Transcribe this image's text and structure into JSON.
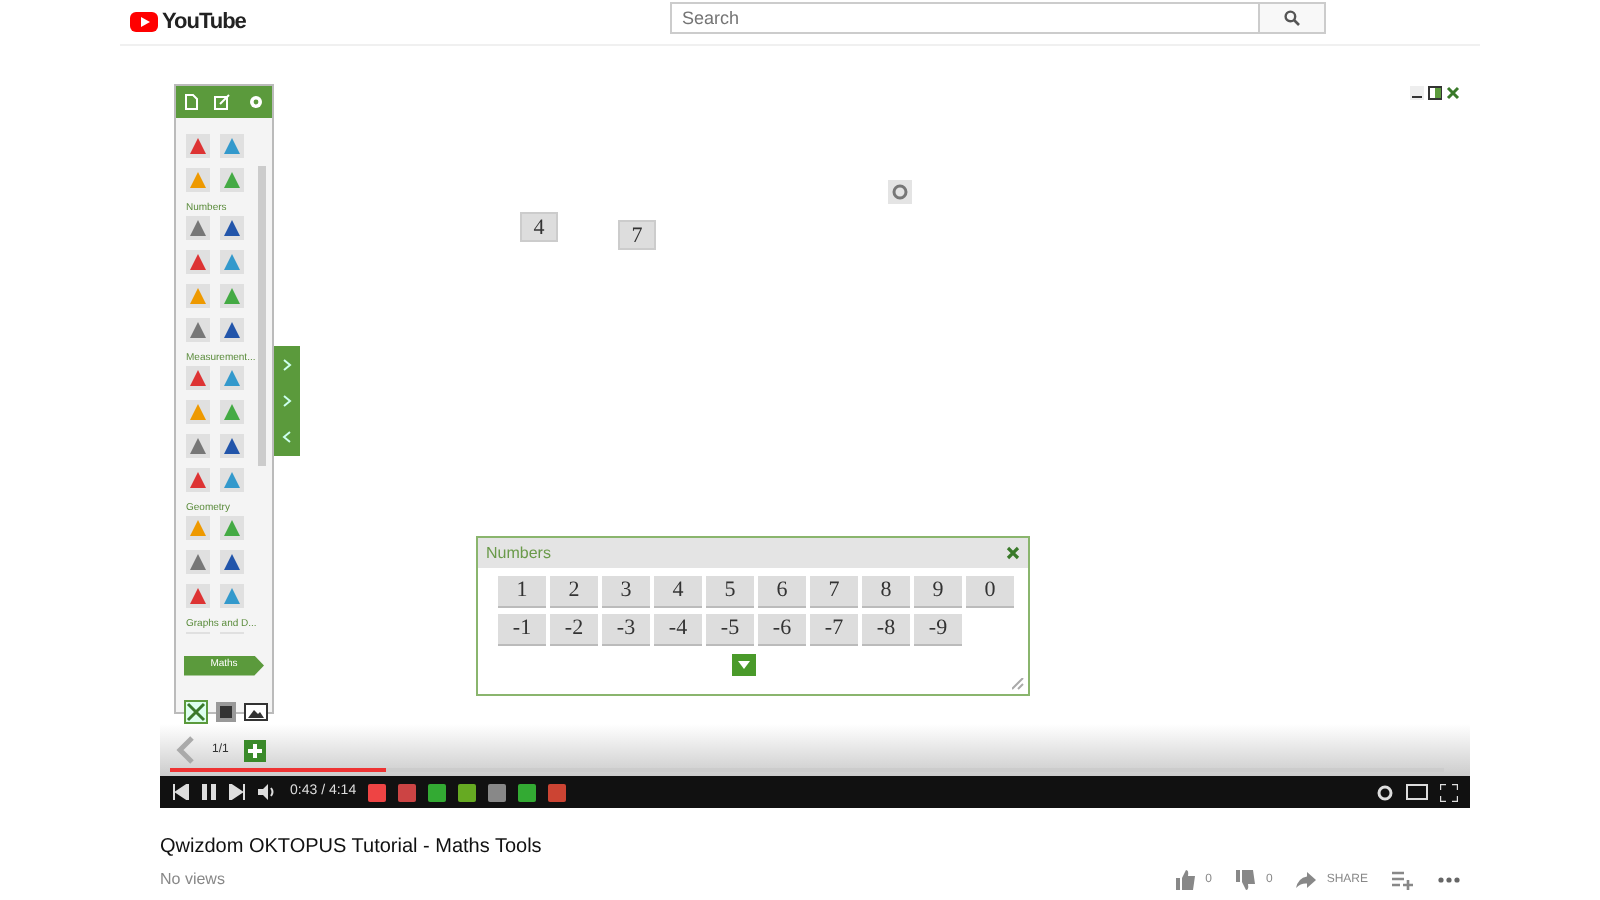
{
  "header": {
    "logo": "YouTube",
    "search": {
      "placeholder": "Search"
    }
  },
  "video": {
    "toolbar": {
      "sections": [
        {
          "label": "Numbers"
        },
        {
          "label": "Measurement..."
        },
        {
          "label": "Geometry"
        },
        {
          "label": "Graphs and D..."
        }
      ],
      "category_button": "Maths"
    },
    "cards": [
      "4",
      "7"
    ],
    "numbers_panel": {
      "title": "Numbers",
      "key_rows": [
        [
          "1",
          "2",
          "3",
          "4",
          "5",
          "6",
          "7",
          "8",
          "9",
          "0"
        ],
        [
          "-1",
          "-2",
          "-3",
          "-4",
          "-5",
          "-6",
          "-7",
          "-8",
          "-9"
        ]
      ]
    },
    "page_indicator": "1/1",
    "player": {
      "time": "0:43 / 4:14",
      "progress": {
        "level": 0.17
      }
    }
  },
  "title": "Qwizdom OKTOPUS Tutorial - Maths Tools",
  "views": "No views",
  "actions": [
    {
      "kind": "like",
      "label": "0"
    },
    {
      "kind": "dislike",
      "label": "0"
    },
    {
      "kind": "share",
      "label": "SHARE"
    },
    {
      "kind": "add"
    },
    {
      "kind": "more"
    }
  ]
}
